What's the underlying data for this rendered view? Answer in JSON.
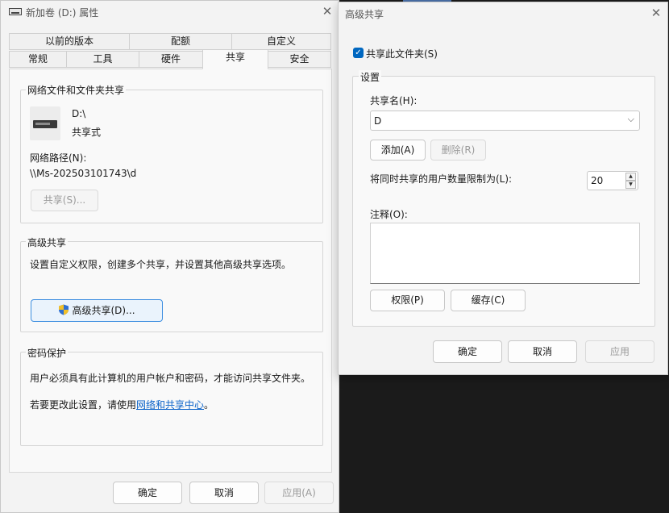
{
  "left_window": {
    "title": "新加卷 (D:) 属性",
    "tabs_row1": [
      "以前的版本",
      "配额",
      "自定义"
    ],
    "tabs_row2": [
      "常规",
      "工具",
      "硬件",
      "共享",
      "安全"
    ],
    "active_tab": "共享",
    "network_group": {
      "label": "网络文件和文件夹共享",
      "drive_name": "D:\\",
      "share_status": "共享式",
      "path_label": "网络路径(N):",
      "path_value": "\\\\Ms-202503101743\\d",
      "share_button": "共享(S)..."
    },
    "advanced_group": {
      "label": "高级共享",
      "description": "设置自定义权限，创建多个共享，并设置其他高级共享选项。",
      "button": "高级共享(D)..."
    },
    "password_group": {
      "label": "密码保护",
      "description": "用户必须具有此计算机的用户帐户和密码，才能访问共享文件夹。",
      "change_prefix": "若要更改此设置，请使用",
      "change_link": "网络和共享中心",
      "change_suffix": "。"
    },
    "buttons": {
      "ok": "确定",
      "cancel": "取消",
      "apply": "应用(A)"
    }
  },
  "right_window": {
    "title": "高级共享",
    "share_checkbox_label": "共享此文件夹(S)",
    "share_checkbox_checked": true,
    "settings_label": "设置",
    "share_name_label": "共享名(H):",
    "share_name_value": "D",
    "add_button": "添加(A)",
    "remove_button": "删除(R)",
    "limit_label": "将同时共享的用户数量限制为(L):",
    "limit_value": "20",
    "comment_label": "注释(O):",
    "permissions_button": "权限(P)",
    "cache_button": "缓存(C)",
    "buttons": {
      "ok": "确定",
      "cancel": "取消",
      "apply": "应用"
    }
  },
  "colors": {
    "accent": "#0067c0",
    "link": "#0a62c9",
    "background": "#1b1b1b"
  }
}
